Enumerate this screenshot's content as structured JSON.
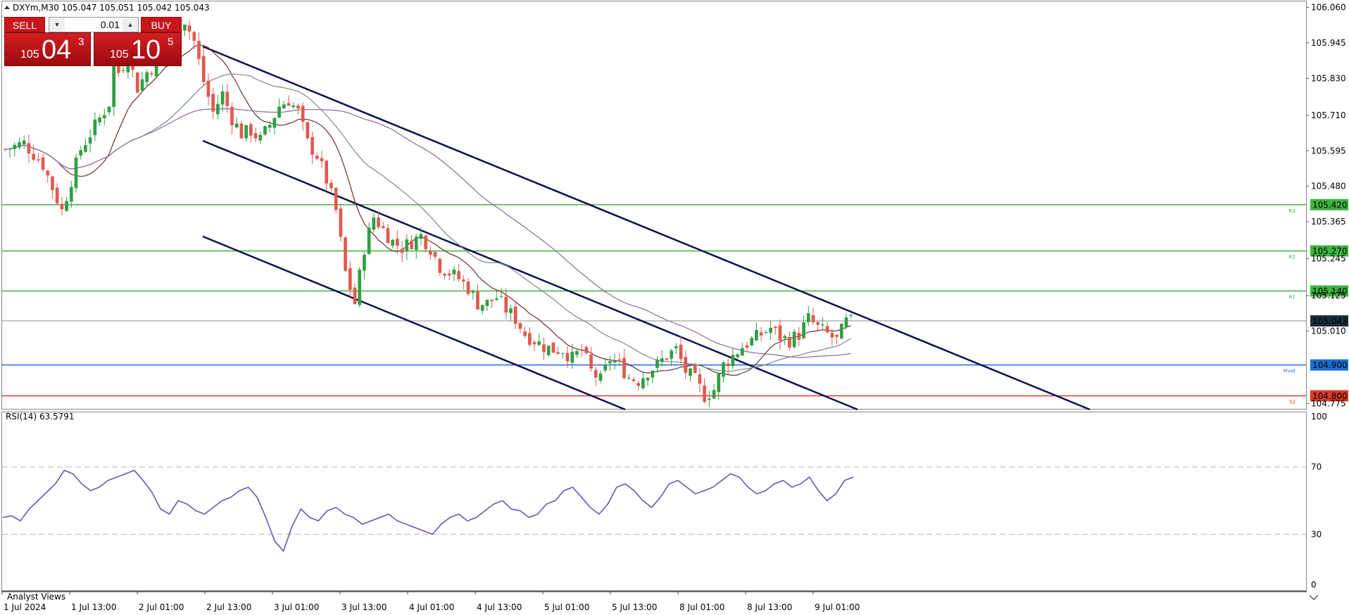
{
  "header": {
    "symbol_label": "DXYm,M30 105.047 105.051 105.042 105.043",
    "collapse_icon": "triangle-up-icon"
  },
  "trade_panel": {
    "sell_label": "SELL",
    "buy_label": "BUY",
    "lot_value": "0.01",
    "sell_price": {
      "big_figure": "105",
      "pips": "04",
      "fraction": "3"
    },
    "buy_price": {
      "big_figure": "105",
      "pips": "10",
      "fraction": "5"
    }
  },
  "price_axis": {
    "ticks": [
      "106.060",
      "105.945",
      "105.830",
      "105.710",
      "105.595",
      "105.480",
      "105.365",
      "105.245",
      "105.125",
      "105.010",
      "104.775"
    ],
    "current_price": "105.043"
  },
  "levels": [
    {
      "label": "105.420",
      "tag": "R3",
      "color": "#3fb33f"
    },
    {
      "label": "105.270",
      "tag": "R2",
      "color": "#3fb33f"
    },
    {
      "label": "105.140",
      "tag": "R1",
      "color": "#3fb33f"
    },
    {
      "label": "104.900",
      "tag": "Pivot",
      "color": "#1a6fd6"
    },
    {
      "label": "104.800",
      "tag": "S2",
      "color": "#d93a2b"
    }
  ],
  "rsi": {
    "label": "RSI(14) 63.5791",
    "ticks": [
      "100",
      "70",
      "30",
      "0"
    ]
  },
  "footer": {
    "analyst_views": "Analyst Views",
    "time_labels": [
      "1 Jul 2024",
      "1 Jul 13:00",
      "2 Jul 01:00",
      "2 Jul 13:00",
      "3 Jul 01:00",
      "3 Jul 13:00",
      "4 Jul 01:00",
      "4 Jul 13:00",
      "5 Jul 01:00",
      "5 Jul 13:00",
      "8 Jul 01:00",
      "8 Jul 13:00",
      "9 Jul 01:00"
    ]
  },
  "colors": {
    "bull": "#2ea043",
    "bear": "#e05a4f",
    "channel": "#0b1150",
    "ma_dark": "#6b2f2f",
    "ma_gray": "#7b8a8a",
    "ma_purple": "#8a6a9a",
    "rsi_line": "#6a55b0"
  },
  "chart_data": {
    "type": "candlestick",
    "instrument": "DXYm",
    "timeframe": "M30",
    "price_range": [
      104.76,
      106.075
    ],
    "close_path": [
      [
        0,
        105.6
      ],
      [
        4,
        105.62
      ],
      [
        8,
        105.55
      ],
      [
        12,
        105.4
      ],
      [
        14,
        105.5
      ],
      [
        16,
        105.6
      ],
      [
        18,
        105.65
      ],
      [
        20,
        105.7
      ],
      [
        22,
        105.75
      ],
      [
        23,
        105.9
      ],
      [
        24,
        105.85
      ],
      [
        26,
        105.9
      ],
      [
        28,
        105.8
      ],
      [
        30,
        105.85
      ],
      [
        32,
        105.88
      ],
      [
        34,
        105.95
      ],
      [
        36,
        106.0
      ],
      [
        38,
        106.02
      ],
      [
        40,
        105.95
      ],
      [
        42,
        105.82
      ],
      [
        44,
        105.72
      ],
      [
        46,
        105.78
      ],
      [
        48,
        105.7
      ],
      [
        50,
        105.65
      ],
      [
        52,
        105.66
      ],
      [
        54,
        105.63
      ],
      [
        56,
        105.68
      ],
      [
        58,
        105.74
      ],
      [
        60,
        105.76
      ],
      [
        62,
        105.72
      ],
      [
        64,
        105.62
      ],
      [
        66,
        105.58
      ],
      [
        68,
        105.5
      ],
      [
        70,
        105.4
      ],
      [
        72,
        105.2
      ],
      [
        74,
        105.1
      ],
      [
        76,
        105.28
      ],
      [
        78,
        105.38
      ],
      [
        80,
        105.34
      ],
      [
        82,
        105.3
      ],
      [
        84,
        105.28
      ],
      [
        86,
        105.3
      ],
      [
        88,
        105.32
      ],
      [
        90,
        105.28
      ],
      [
        92,
        105.22
      ],
      [
        94,
        105.2
      ],
      [
        96,
        105.18
      ],
      [
        98,
        105.15
      ],
      [
        100,
        105.1
      ],
      [
        102,
        105.1
      ],
      [
        104,
        105.12
      ],
      [
        106,
        105.08
      ],
      [
        108,
        105.05
      ],
      [
        110,
        105.0
      ],
      [
        112,
        104.98
      ],
      [
        114,
        104.96
      ],
      [
        116,
        104.95
      ],
      [
        118,
        104.95
      ],
      [
        120,
        104.92
      ],
      [
        122,
        104.95
      ],
      [
        124,
        104.88
      ],
      [
        126,
        104.85
      ],
      [
        128,
        104.92
      ],
      [
        130,
        104.9
      ],
      [
        132,
        104.86
      ],
      [
        134,
        104.85
      ],
      [
        136,
        104.88
      ],
      [
        138,
        104.9
      ],
      [
        140,
        104.93
      ],
      [
        142,
        104.95
      ],
      [
        144,
        104.88
      ],
      [
        146,
        104.85
      ],
      [
        148,
        104.8
      ],
      [
        150,
        104.82
      ],
      [
        152,
        104.9
      ],
      [
        154,
        104.93
      ],
      [
        156,
        104.96
      ],
      [
        158,
        104.98
      ],
      [
        160,
        105.0
      ],
      [
        162,
        105.02
      ],
      [
        164,
        104.99
      ],
      [
        166,
        104.98
      ],
      [
        168,
        105.0
      ],
      [
        170,
        105.05
      ],
      [
        172,
        105.02
      ],
      [
        174,
        105.0
      ],
      [
        176,
        104.98
      ],
      [
        178,
        105.04
      ]
    ],
    "rsi_values": [
      40,
      41,
      38,
      45,
      50,
      55,
      60,
      68,
      66,
      60,
      56,
      58,
      62,
      64,
      66,
      68,
      62,
      55,
      45,
      42,
      50,
      48,
      44,
      42,
      46,
      50,
      52,
      56,
      58,
      52,
      40,
      26,
      20,
      35,
      45,
      40,
      38,
      44,
      46,
      42,
      40,
      36,
      38,
      40,
      42,
      38,
      36,
      34,
      32,
      30,
      36,
      40,
      42,
      38,
      40,
      44,
      48,
      50,
      45,
      44,
      40,
      42,
      48,
      50,
      56,
      58,
      52,
      46,
      42,
      48,
      58,
      60,
      56,
      50,
      46,
      52,
      60,
      62,
      58,
      54,
      56,
      58,
      62,
      66,
      64,
      58,
      54,
      56,
      60,
      62,
      58,
      60,
      64,
      56,
      50,
      54,
      62,
      64
    ],
    "rsi_range": [
      0,
      100
    ],
    "rsi_levels": [
      70,
      30
    ]
  }
}
